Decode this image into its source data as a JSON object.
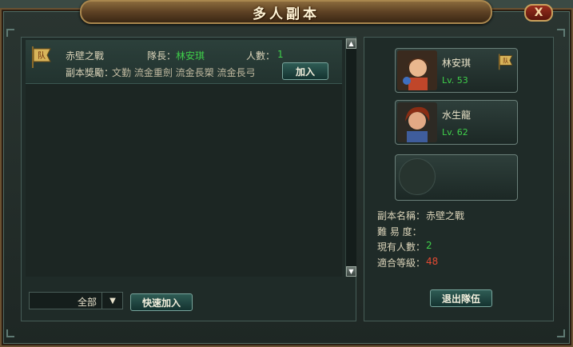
{
  "dialog": {
    "title": "多人副本",
    "close_label": "X"
  },
  "list": {
    "rows": [
      {
        "dungeon": "赤壁之戰",
        "captain_label": "隊長：",
        "captain": "林安琪",
        "count_label": "人數：",
        "count": "1",
        "reward_label": "副本獎勵：",
        "rewards": "文勤  流金重劍  流金長槊  流金長弓",
        "join_label": "加入"
      }
    ]
  },
  "filter": {
    "selected": "全部"
  },
  "quick_join_label": "快速加入",
  "party": {
    "members": [
      {
        "name": "林安琪",
        "level": "Lv. 53",
        "leader": true
      },
      {
        "name": "水生龍",
        "level": "Lv. 62",
        "leader": false
      }
    ],
    "empty_slot": true
  },
  "details": {
    "name_label": "副本名稱：",
    "name": "赤壁之戰",
    "difficulty_label": "難 易 度：",
    "difficulty": "",
    "current_label": "現有人數：",
    "current": "2",
    "level_label": "適合等級：",
    "level": "48"
  },
  "leave_label": "退出隊伍",
  "icon_flag_char": "队",
  "colors": {
    "green": "#3fcf4a",
    "red": "#e34a33",
    "frame": "#6b5232"
  }
}
